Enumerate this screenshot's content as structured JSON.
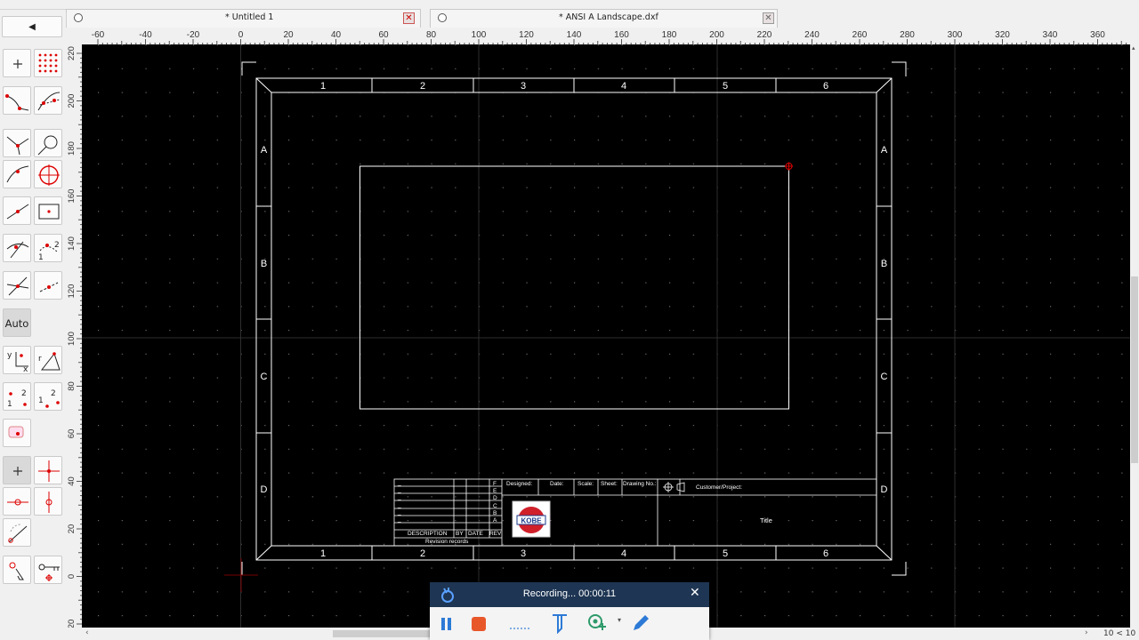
{
  "tabs": [
    {
      "title": "* Untitled 1"
    },
    {
      "title": "* ANSI A Landscape.dxf"
    }
  ],
  "toolbox": {
    "collapse_label": "◀",
    "auto_label": "Auto",
    "tools": [
      {
        "name": "point-tool",
        "icon": "plus-icon"
      },
      {
        "name": "grid-points-tool",
        "icon": "dot-grid-icon"
      },
      {
        "name": "snap-to-curve-tool",
        "icon": "curve-snap-icon"
      },
      {
        "name": "snap-intersection-tool",
        "icon": "intersection-icon"
      },
      {
        "name": "snap-tangent-tool",
        "icon": "tangent-icon"
      },
      {
        "name": "snap-circle-tool",
        "icon": "circle-snap-icon"
      },
      {
        "name": "snap-endpoint-tool",
        "icon": "endpoint-icon"
      },
      {
        "name": "snap-center-tool",
        "icon": "center-icon"
      },
      {
        "name": "snap-middle-tool",
        "icon": "middle-icon"
      },
      {
        "name": "snap-rect-tool",
        "icon": "rect-snap-icon"
      },
      {
        "name": "snap-distance-tool",
        "icon": "distance-icon"
      },
      {
        "name": "snap-nearest-tool",
        "icon": "nearest-icon"
      },
      {
        "name": "snap-perpendicular-tool",
        "icon": "perpendicular-icon"
      },
      {
        "name": "snap-onentity-tool",
        "icon": "on-entity-icon"
      },
      {
        "name": "restrict-xy-tool",
        "icon": "restrict-xy-icon"
      },
      {
        "name": "restrict-angle-tool",
        "icon": "restrict-angle-icon"
      },
      {
        "name": "relative-zero-tool",
        "icon": "relative-zero-icon"
      },
      {
        "name": "lock-relative-zero-tool",
        "icon": "lock-zero-icon"
      },
      {
        "name": "snap-free-tool",
        "icon": "free-snap-icon"
      },
      {
        "name": "snap-grid-tool",
        "icon": "grid-snap-icon"
      },
      {
        "name": "restrict-horizontal-tool",
        "icon": "horizontal-icon"
      },
      {
        "name": "restrict-vertical-tool",
        "icon": "vertical-icon"
      },
      {
        "name": "restrict-nothing-tool",
        "icon": "nothing-icon"
      },
      {
        "name": "select-tool",
        "icon": "select-icon"
      },
      {
        "name": "key-tool",
        "icon": "key-icon"
      }
    ]
  },
  "ruler": {
    "x_labels": [
      "-60",
      "-40",
      "-20",
      "0",
      "20",
      "40",
      "60",
      "80",
      "100",
      "120",
      "140",
      "160",
      "180",
      "200",
      "220",
      "240",
      "260",
      "280",
      "300",
      "320",
      "340",
      "360"
    ],
    "y_labels": [
      "220",
      "200",
      "180",
      "160",
      "140",
      "120",
      "100",
      "80",
      "60",
      "40",
      "20",
      "0",
      "20"
    ]
  },
  "drawing": {
    "col_labels": [
      "1",
      "2",
      "3",
      "4",
      "5",
      "6"
    ],
    "row_labels": [
      "A",
      "B",
      "C",
      "D"
    ],
    "title_block": {
      "designed": "Designed:",
      "date": "Date:",
      "scale": "Scale:",
      "sheet": "Sheet:",
      "drawing_no": "Drawing No.:",
      "customer": "Customer/Project:",
      "title": "Title",
      "description": "DESCRIPTION",
      "by": "BY",
      "date_col": "DATE",
      "rev": "REV",
      "revision_records": "Revision records",
      "dash": "_",
      "rev_letters": [
        "F",
        "E",
        "D",
        "C",
        "B",
        "A"
      ],
      "logo_text": "KOBE"
    }
  },
  "recording": {
    "status": "Recording... 00:00:11"
  },
  "statusbar": {
    "zoom": "10 < 10"
  },
  "colors": {
    "canvas": "#000000",
    "drawing_line": "#ffffff",
    "grid_dot": "#6b6b6b",
    "accent_red": "#cc0000",
    "recorder_bg": "#1e3553"
  }
}
